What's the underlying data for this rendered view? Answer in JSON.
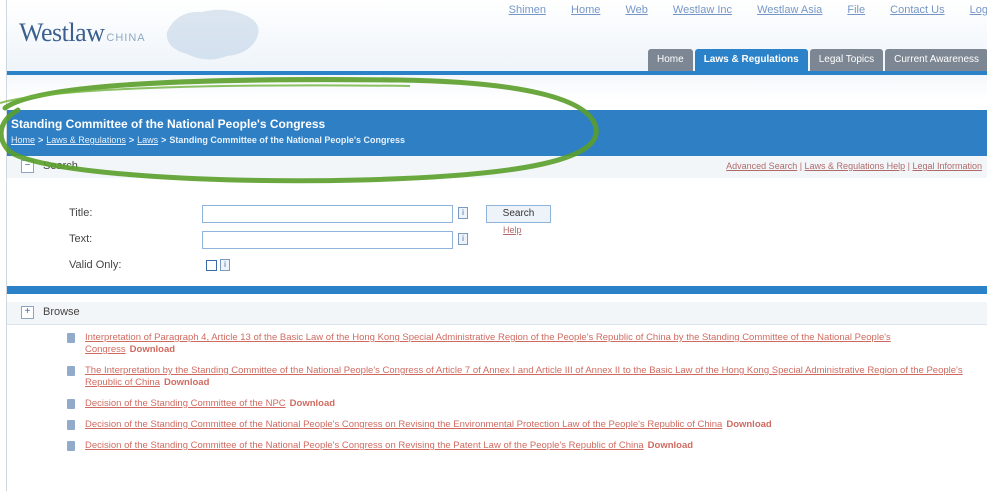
{
  "header": {
    "logo": "Westlaw",
    "logo_sub": "CHINA",
    "util_links": [
      "Shimen",
      "Home",
      "Web",
      "Westlaw Inc",
      "Westlaw Asia",
      "File",
      "Contact Us",
      "Log"
    ],
    "tabs": [
      {
        "label": "Home",
        "active": false
      },
      {
        "label": "Laws & Regulations",
        "active": true
      },
      {
        "label": "Legal Topics",
        "active": false
      },
      {
        "label": "Current Awareness",
        "active": false
      }
    ]
  },
  "banner": {
    "title": "Standing Committee of the National People's Congress",
    "breadcrumb": [
      "Home",
      "Laws & Regulations",
      "Laws"
    ],
    "breadcrumb_current": "Standing Committee of the National People's Congress"
  },
  "search": {
    "toggle_symbol": "−",
    "title": "Search",
    "links": [
      "Advanced Search",
      "Laws & Regulations Help",
      "Legal Information"
    ],
    "title_label": "Title:",
    "text_label": "Text:",
    "valid_label": "Valid Only:",
    "button": "Search",
    "help": "Help",
    "info_symbol": "i"
  },
  "browse": {
    "toggle_symbol": "+",
    "title": "Browse",
    "download_label": "Download",
    "items": [
      "Interpretation of Paragraph 4, Article 13 of the Basic Law of the Hong Kong Special Administrative Region of the People's Republic of China by the Standing Committee of the National People's Congress",
      "The Interpretation by the Standing Committee of the National People's Congress of Article 7 of Annex I and Article III of Annex II to the Basic Law of the Hong Kong Special Administrative Region of the People's Republic of China",
      "Decision of the Standing Committee of the NPC",
      "Decision of the Standing Committee of the National People's Congress on Revising the Environmental Protection Law of the People's Republic of China",
      "Decision of the Standing Committee of the National People's Congress on Revising the Patent Law of the People's Republic of China"
    ]
  }
}
